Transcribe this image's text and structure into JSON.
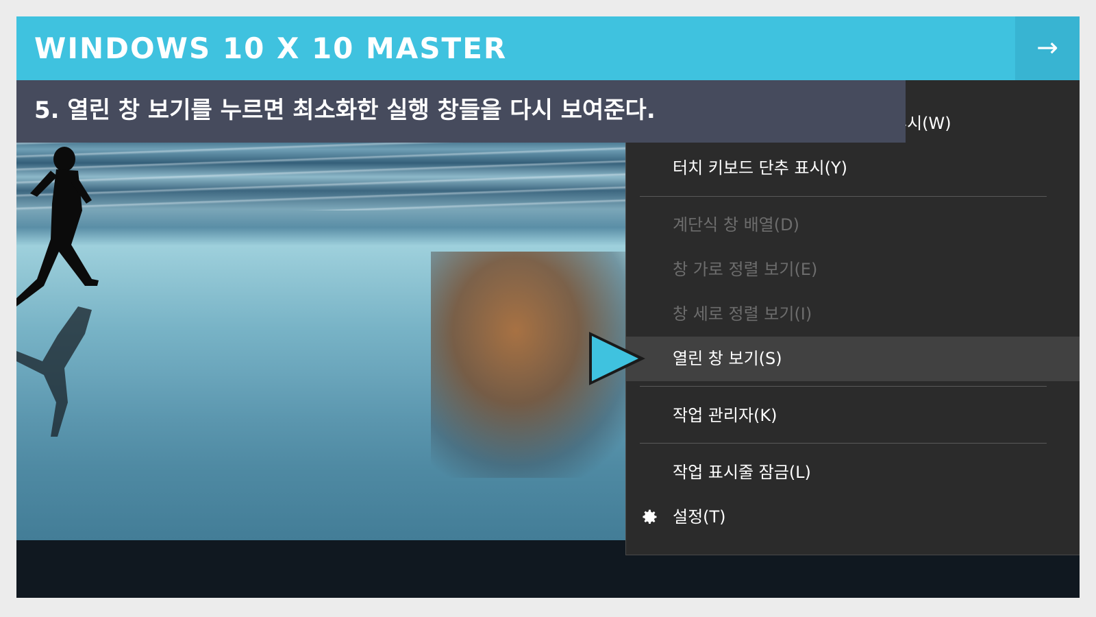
{
  "header": {
    "title": "WINDOWS 10 X 10 MASTER",
    "next_icon": "→"
  },
  "caption": {
    "text": "5. 열린 창 보기를 누르면 최소화한 실행 창들을 다시 보여준다."
  },
  "menu": {
    "items": [
      {
        "label": "ㅗ시(W)",
        "state": "partially-hidden"
      },
      {
        "label": "터치 키보드 단추 표시(Y)",
        "state": "enabled"
      },
      {
        "label": "계단식 창 배열(D)",
        "state": "disabled"
      },
      {
        "label": "창 가로 정렬 보기(E)",
        "state": "disabled"
      },
      {
        "label": "창 세로 정렬 보기(I)",
        "state": "disabled"
      },
      {
        "label": "열린 창 보기(S)",
        "state": "highlighted"
      },
      {
        "label": "작업 관리자(K)",
        "state": "enabled"
      },
      {
        "label": "작업 표시줄 잠금(L)",
        "state": "enabled"
      },
      {
        "label": "설정(T)",
        "state": "enabled",
        "icon": "gear-icon"
      }
    ]
  },
  "colors": {
    "accent": "#3fc2df",
    "caption_bg": "#464b5d",
    "menu_bg": "#2b2b2b",
    "menu_highlight": "#414141",
    "pointer": "#3fc2df"
  }
}
